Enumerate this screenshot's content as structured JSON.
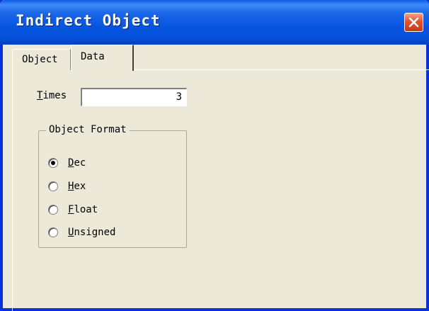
{
  "window": {
    "title": "Indirect Object"
  },
  "tabs": [
    {
      "label": "Object",
      "active": false
    },
    {
      "label": "Data",
      "active": true
    }
  ],
  "times": {
    "label_mnemonic": "T",
    "label_rest": "imes",
    "value": "3"
  },
  "object_format": {
    "title": "Object Format",
    "selected": "Dec",
    "options": [
      {
        "mnemonic": "D",
        "rest": "ec",
        "selected": true
      },
      {
        "mnemonic": "H",
        "rest": "ex",
        "selected": false
      },
      {
        "mnemonic": "F",
        "rest": "loat",
        "selected": false
      },
      {
        "mnemonic": "U",
        "rest": "nsigned",
        "selected": false
      }
    ]
  },
  "colors": {
    "titlebar": "#0a58e6",
    "window_bg": "#ece9d8",
    "close_button": "#e2532a"
  },
  "icons": {
    "close": "close-icon"
  }
}
